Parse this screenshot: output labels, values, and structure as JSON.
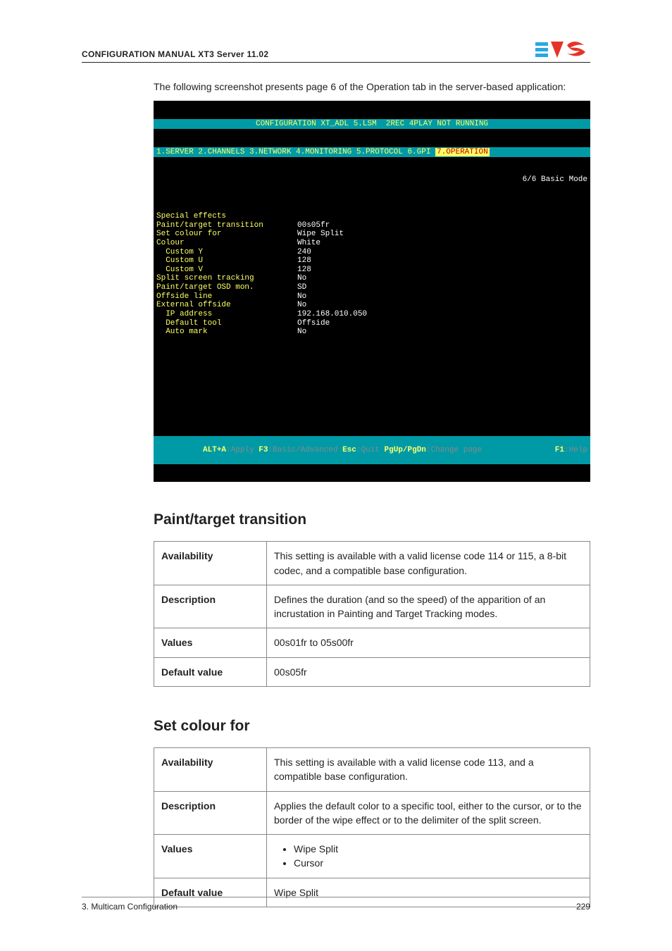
{
  "header": {
    "title": "CONFIGURATION MANUAL   XT3 Server 11.02"
  },
  "intro": "The following screenshot presents page 6 of the Operation tab in the server-based application:",
  "terminal": {
    "title": "CONFIGURATION XT_ADL 5.LSM  2REC 4PLAY NOT RUNNING",
    "tabs_prefix": "1.SERVER 2.CHANNELS 3.NETWORK 4.MONITORING 5.PROTOCOL 6.GPI ",
    "tabs_active": "7.OPERATION",
    "mode": "6/6 Basic Mode",
    "section": "Special effects",
    "rows": [
      {
        "label": "Paint/target transition",
        "value": "00s05fr"
      },
      {
        "label": "Set colour for",
        "value": "Wipe Split"
      },
      {
        "label": "Colour",
        "value": "White"
      },
      {
        "label": "  Custom Y",
        "value": "240"
      },
      {
        "label": "  Custom U",
        "value": "128"
      },
      {
        "label": "  Custom V",
        "value": "128"
      },
      {
        "label": "Split screen tracking",
        "value": "No"
      },
      {
        "label": "Paint/target OSD mon.",
        "value": "SD"
      },
      {
        "label": "Offside line",
        "value": "No"
      },
      {
        "label": "External offside",
        "value": "No"
      },
      {
        "label": "  IP address",
        "value": "192.168.010.050"
      },
      {
        "label": "  Default tool",
        "value": "Offside"
      },
      {
        "label": "  Auto mark",
        "value": "No"
      }
    ],
    "footer": {
      "k1": "ALT+A",
      "v1": ":Apply ",
      "k2": "F3",
      "v2": ":Basic/Advanced ",
      "k3": "Esc",
      "v3": ":Quit ",
      "k4": "PgUp/PgDn",
      "v4": ":Change page",
      "k5": "F1",
      "v5": ":Help"
    }
  },
  "sections": [
    {
      "heading": "Paint/target transition",
      "rows": {
        "availability_k": "Availability",
        "availability_v": "This setting is available with a valid license code 114 or 115, a 8-bit codec, and a compatible base configuration.",
        "description_k": "Description",
        "description_v": "Defines the duration (and so the speed) of the apparition of an incrustation in Painting and Target Tracking modes.",
        "values_k": "Values",
        "values_v": "00s01fr to 05s00fr",
        "default_k": "Default value",
        "default_v": "00s05fr"
      }
    },
    {
      "heading": "Set colour for",
      "rows": {
        "availability_k": "Availability",
        "availability_v": "This setting is available with a valid license code 113, and a compatible base configuration.",
        "description_k": "Description",
        "description_v": "Applies the default color to a specific tool, either to the cursor, or to the border of the wipe effect or to the delimiter of the split screen.",
        "values_k": "Values",
        "values_list": [
          "Wipe Split",
          "Cursor"
        ],
        "default_k": "Default value",
        "default_v": "Wipe Split"
      }
    }
  ],
  "footer": {
    "left": "3. Multicam Configuration",
    "right": "229"
  }
}
